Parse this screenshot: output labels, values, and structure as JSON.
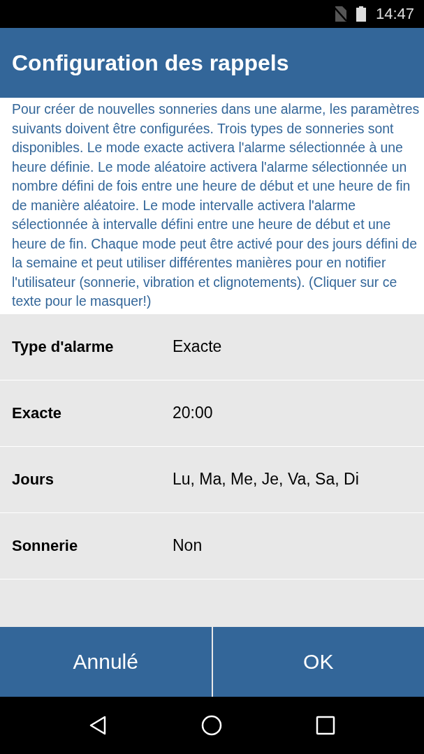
{
  "status_bar": {
    "time": "14:47"
  },
  "header": {
    "title": "Configuration des rappels"
  },
  "description": "Pour créer de nouvelles sonneries dans une alarme, les paramètres suivants doivent être configurées. Trois types de sonneries sont disponibles. Le mode exacte activera l'alarme sélectionnée à une heure définie. Le mode aléatoire activera l'alarme sélectionnée un nombre défini de fois entre une heure de début et une heure de fin de manière aléatoire. Le mode intervalle activera l'alarme sélectionnée à intervalle défini entre une heure de début et une heure de fin. Chaque mode peut être activé pour des jours défini de la semaine et peut utiliser différentes manières pour en notifier l'utilisateur (sonnerie, vibration et clignotements). (Cliquer sur ce texte pour le masquer!)",
  "settings": [
    {
      "label": "Type d'alarme",
      "value": "Exacte"
    },
    {
      "label": "Exacte",
      "value": "20:00"
    },
    {
      "label": "Jours",
      "value": "Lu, Ma, Me, Je, Va, Sa, Di"
    },
    {
      "label": "Sonnerie",
      "value": "Non"
    }
  ],
  "buttons": [
    "Annulé",
    "OK"
  ]
}
